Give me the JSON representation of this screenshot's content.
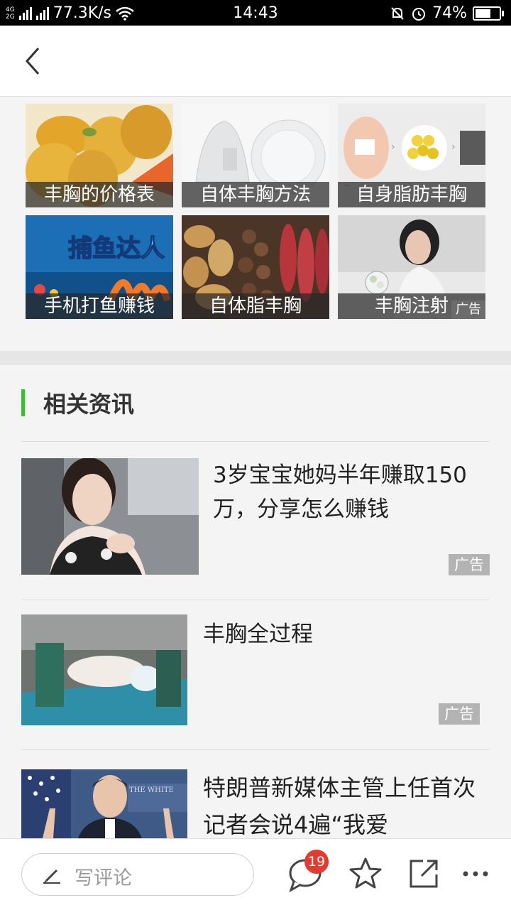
{
  "status_bar": {
    "network_tags": [
      "4G",
      "2G"
    ],
    "speed": "77.3K/s",
    "time": "14:43",
    "battery": "74%",
    "battery_level": 0.74
  },
  "grid": {
    "tiles": [
      {
        "caption": "丰胸的价格表",
        "image": "papaya-photo"
      },
      {
        "caption": "自体丰胸方法",
        "image": "suction-cups-photo"
      },
      {
        "caption": "自身脂肪丰胸",
        "image": "procedure-diagram-photo"
      },
      {
        "caption": "手机打鱼赚钱",
        "image": "fishing-game-banner",
        "logo_text": "捕鱼达人"
      },
      {
        "caption": "自体脂丰胸",
        "image": "potatoes-photo"
      },
      {
        "caption": "丰胸注射",
        "image": "bride-photo",
        "ad": "广告"
      }
    ]
  },
  "section": {
    "title": "相关资讯"
  },
  "news": [
    {
      "title": "3岁宝宝她妈半年赚取150万，分享怎么赚钱",
      "ad": "广告",
      "image": "woman-in-car-photo"
    },
    {
      "title": "丰胸全过程",
      "ad": "广告",
      "image": "surgery-photo"
    },
    {
      "title": "特朗普新媒体主管上任首次记者会说4遍“我爱",
      "image": "press-conference-photo",
      "image_text": "THE WHITE"
    }
  ],
  "bottom_bar": {
    "comment_placeholder": "写评论",
    "comment_count": "19",
    "icons": [
      "pencil-icon",
      "comment-icon",
      "star-icon",
      "share-icon",
      "more-icon"
    ]
  }
}
